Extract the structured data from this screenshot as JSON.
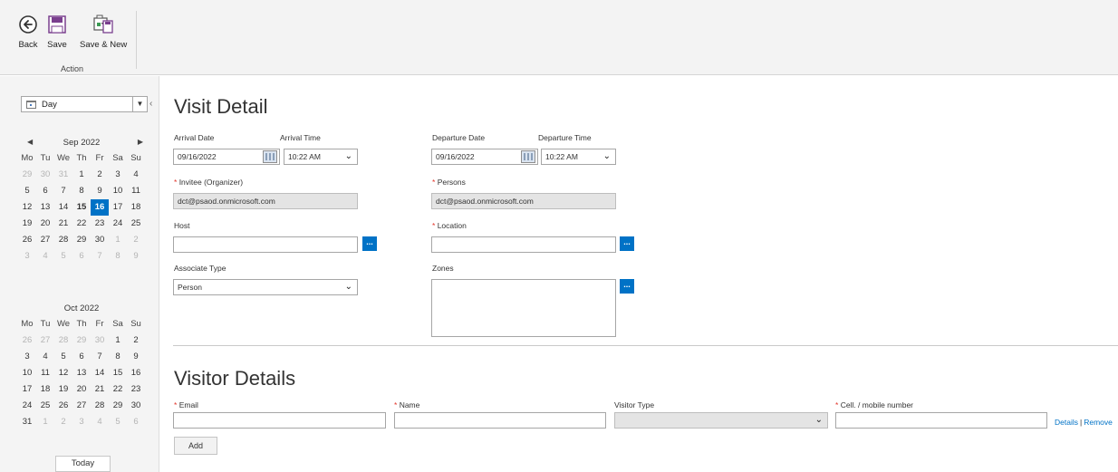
{
  "ribbon": {
    "back_label": "Back",
    "save_label": "Save",
    "save_new_label": "Save & New",
    "group_label": "Action"
  },
  "calendar": {
    "view_selected": "Day",
    "today_label": "Today",
    "dow": [
      "Mo",
      "Tu",
      "We",
      "Th",
      "Fr",
      "Sa",
      "Su"
    ],
    "months": [
      {
        "title": "Sep 2022",
        "days": [
          [
            "29",
            "m"
          ],
          [
            "30",
            "m"
          ],
          [
            "31",
            "m"
          ],
          [
            "1",
            ""
          ],
          [
            "2",
            ""
          ],
          [
            "3",
            ""
          ],
          [
            "4",
            ""
          ],
          [
            "5",
            ""
          ],
          [
            "6",
            ""
          ],
          [
            "7",
            ""
          ],
          [
            "8",
            ""
          ],
          [
            "9",
            ""
          ],
          [
            "10",
            ""
          ],
          [
            "11",
            ""
          ],
          [
            "12",
            ""
          ],
          [
            "13",
            ""
          ],
          [
            "14",
            ""
          ],
          [
            "15",
            "b"
          ],
          [
            "16",
            "s"
          ],
          [
            "17",
            ""
          ],
          [
            "18",
            ""
          ],
          [
            "19",
            ""
          ],
          [
            "20",
            ""
          ],
          [
            "21",
            ""
          ],
          [
            "22",
            ""
          ],
          [
            "23",
            ""
          ],
          [
            "24",
            ""
          ],
          [
            "25",
            ""
          ],
          [
            "26",
            ""
          ],
          [
            "27",
            ""
          ],
          [
            "28",
            ""
          ],
          [
            "29",
            ""
          ],
          [
            "30",
            ""
          ],
          [
            "1",
            "m"
          ],
          [
            "2",
            "m"
          ],
          [
            "3",
            "m"
          ],
          [
            "4",
            "m"
          ],
          [
            "5",
            "m"
          ],
          [
            "6",
            "m"
          ],
          [
            "7",
            "m"
          ],
          [
            "8",
            "m"
          ],
          [
            "9",
            "m"
          ]
        ]
      },
      {
        "title": "Oct 2022",
        "days": [
          [
            "26",
            "m"
          ],
          [
            "27",
            "m"
          ],
          [
            "28",
            "m"
          ],
          [
            "29",
            "m"
          ],
          [
            "30",
            "m"
          ],
          [
            "1",
            ""
          ],
          [
            "2",
            ""
          ],
          [
            "3",
            ""
          ],
          [
            "4",
            ""
          ],
          [
            "5",
            ""
          ],
          [
            "6",
            ""
          ],
          [
            "7",
            ""
          ],
          [
            "8",
            ""
          ],
          [
            "9",
            ""
          ],
          [
            "10",
            ""
          ],
          [
            "11",
            ""
          ],
          [
            "12",
            ""
          ],
          [
            "13",
            ""
          ],
          [
            "14",
            ""
          ],
          [
            "15",
            ""
          ],
          [
            "16",
            ""
          ],
          [
            "17",
            ""
          ],
          [
            "18",
            ""
          ],
          [
            "19",
            ""
          ],
          [
            "20",
            ""
          ],
          [
            "21",
            ""
          ],
          [
            "22",
            ""
          ],
          [
            "23",
            ""
          ],
          [
            "24",
            ""
          ],
          [
            "25",
            ""
          ],
          [
            "26",
            ""
          ],
          [
            "27",
            ""
          ],
          [
            "28",
            ""
          ],
          [
            "29",
            ""
          ],
          [
            "30",
            ""
          ],
          [
            "31",
            ""
          ],
          [
            "1",
            "m"
          ],
          [
            "2",
            "m"
          ],
          [
            "3",
            "m"
          ],
          [
            "4",
            "m"
          ],
          [
            "5",
            "m"
          ],
          [
            "6",
            "m"
          ]
        ]
      }
    ]
  },
  "visit": {
    "title": "Visit Detail",
    "arrival_date_label": "Arrival Date",
    "arrival_time_label": "Arrival Time",
    "arrival_date": "09/16/2022",
    "arrival_time": "10:22 AM",
    "departure_date_label": "Departure Date",
    "departure_time_label": "Departure Time",
    "departure_date": "09/16/2022",
    "departure_time": "10:22 AM",
    "invitee_label": "Invitee (Organizer)",
    "invitee_value": "dct@psaod.onmicrosoft.com",
    "persons_label": "Persons",
    "persons_value": "dct@psaod.onmicrosoft.com",
    "host_label": "Host",
    "host_value": "",
    "location_label": "Location",
    "location_value": "",
    "associate_type_label": "Associate Type",
    "associate_type_value": "Person",
    "zones_label": "Zones",
    "lookup_glyph": "..."
  },
  "visitor": {
    "title": "Visitor Details",
    "email_label": "Email",
    "name_label": "Name",
    "type_label": "Visitor Type",
    "mobile_label": "Cell. / mobile number",
    "add_label": "Add",
    "details_link": "Details",
    "link_sep": "|",
    "remove_link": "Remove"
  },
  "required_mark": "*",
  "colors": {
    "accent": "#0072c6",
    "required": "#e2362b"
  }
}
